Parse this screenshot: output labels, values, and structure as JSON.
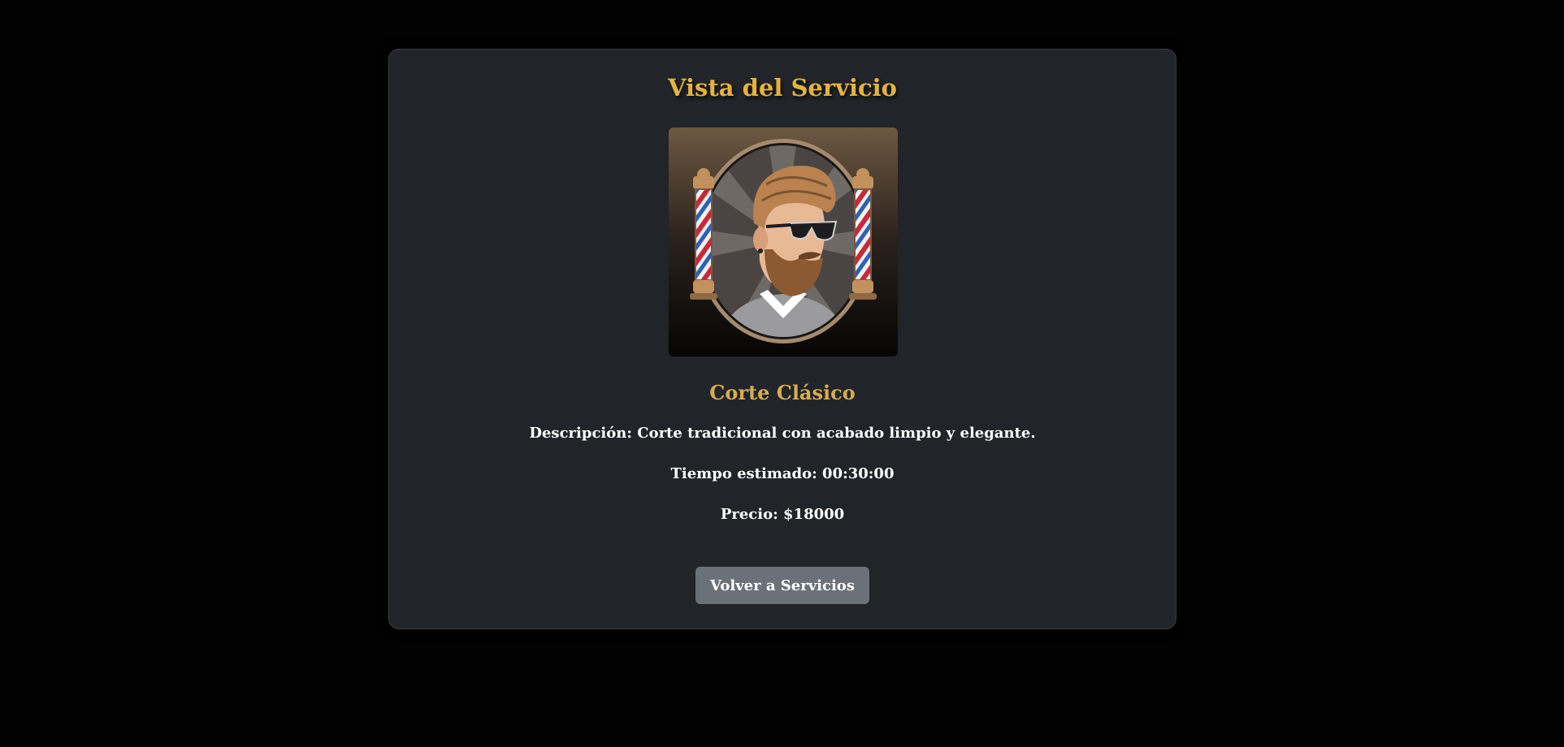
{
  "page": {
    "title": "Vista del Servicio"
  },
  "service": {
    "name": "Corte Clásico",
    "description_line": "Descripción: Corte tradicional con acabado limpio y elegante.",
    "time_line": "Tiempo estimado: 00:30:00",
    "price_line": "Precio: $18000",
    "image_icon": "barber-logo-icon"
  },
  "actions": {
    "back_label": "Volver a Servicios"
  },
  "colors": {
    "page_background": "#020202",
    "card_background": "#212429",
    "title_gold": "#e3b33b",
    "name_gold": "#d6ad4e",
    "button_gray": "#6b7179"
  }
}
